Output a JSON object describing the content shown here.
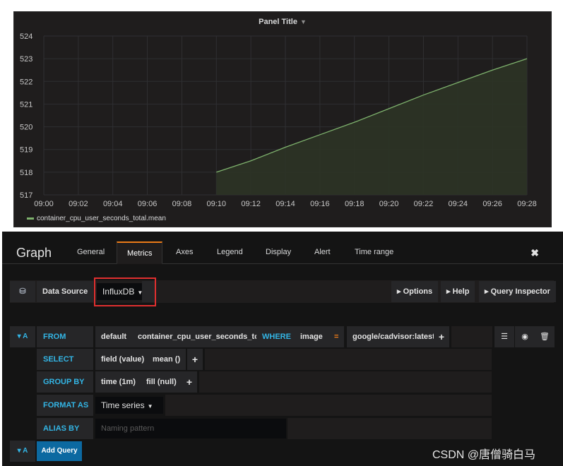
{
  "panel": {
    "title": "Panel Title"
  },
  "chart_data": {
    "type": "area",
    "x": [
      "09:10",
      "09:12",
      "09:14",
      "09:16",
      "09:18",
      "09:20",
      "09:22",
      "09:24",
      "09:26",
      "09:28"
    ],
    "series": [
      {
        "name": "container_cpu_user_seconds_total.mean",
        "values": [
          518.0,
          518.5,
          519.1,
          519.65,
          520.2,
          520.8,
          521.4,
          521.95,
          522.5,
          523.0
        ]
      }
    ],
    "x_ticks": [
      "09:00",
      "09:02",
      "09:04",
      "09:06",
      "09:08",
      "09:10",
      "09:12",
      "09:14",
      "09:16",
      "09:18",
      "09:20",
      "09:22",
      "09:24",
      "09:26",
      "09:28"
    ],
    "y_ticks": [
      517,
      518,
      519,
      520,
      521,
      522,
      523,
      524
    ],
    "ylim": [
      517,
      524
    ],
    "grid": true,
    "legend_placement": "bottom-left",
    "colors": {
      "line": "#7eb26d",
      "fill": "#2c3426"
    }
  },
  "editor": {
    "title": "Graph",
    "tabs": [
      "General",
      "Metrics",
      "Axes",
      "Legend",
      "Display",
      "Alert",
      "Time range"
    ],
    "active_tab": "Metrics",
    "close_icon": "close-icon"
  },
  "datasource": {
    "label": "Data Source",
    "value": "InfluxDB",
    "options_label": "Options",
    "help_label": "Help",
    "inspector_label": "Query Inspector"
  },
  "query": {
    "ref": "A",
    "from_label": "FROM",
    "policy": "default",
    "measurement": "container_cpu_user_seconds_total",
    "where_label": "WHERE",
    "tag": "image",
    "operator": "=",
    "tag_value": "google/cadvisor:latest",
    "select_label": "SELECT",
    "field": "field (value)",
    "aggregate": "mean ()",
    "group_label": "GROUP BY",
    "group_time": "time (1m)",
    "group_fill": "fill (null)",
    "format_label": "FORMAT AS",
    "format_value": "Time series",
    "alias_label": "ALIAS BY",
    "alias_placeholder": "Naming pattern"
  },
  "add_query": {
    "ref": "A",
    "label": "Add Query"
  },
  "watermark": "CSDN @唐僧骑白马"
}
